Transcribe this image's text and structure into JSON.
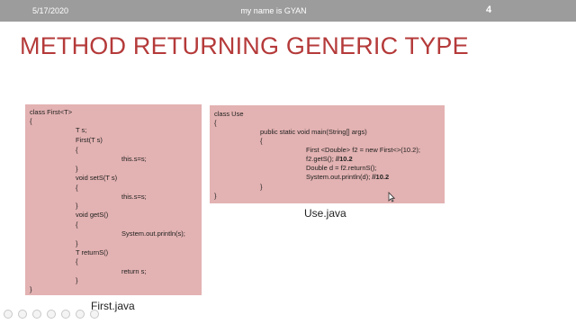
{
  "header": {
    "date": "5/17/2020",
    "author": "my name is GYAN",
    "slide_number": "4"
  },
  "title": "METHOD RETURNING GENERIC TYPE",
  "first_box": {
    "caption": "First.java",
    "lines": [
      "class First<T>",
      "{",
      "T s;",
      "First(T s)",
      "{",
      "this.s=s;",
      "}",
      "void setS(T s)",
      "{",
      "this.s=s;",
      "}",
      "void getS()",
      "{",
      "System.out.println(s);",
      "}",
      "T returnS()",
      "{",
      "return s;",
      "}",
      "}"
    ]
  },
  "use_box": {
    "caption": "Use.java",
    "lines": [
      "class Use",
      "{",
      "public static void main(String[] args)",
      "{",
      "First <Double> f2 = new First<>(10.2);",
      "f2.getS();",
      "//10.2",
      "Double d =  f2.returnS();",
      "System.out.println(d);",
      "//10.2",
      "}",
      "}"
    ]
  },
  "bottom_toolbar": {
    "icons": [
      "back-icon",
      "forward-icon",
      "pen-icon",
      "pointer-icon",
      "slides-icon",
      "zoom-icon",
      "more-icon"
    ]
  }
}
